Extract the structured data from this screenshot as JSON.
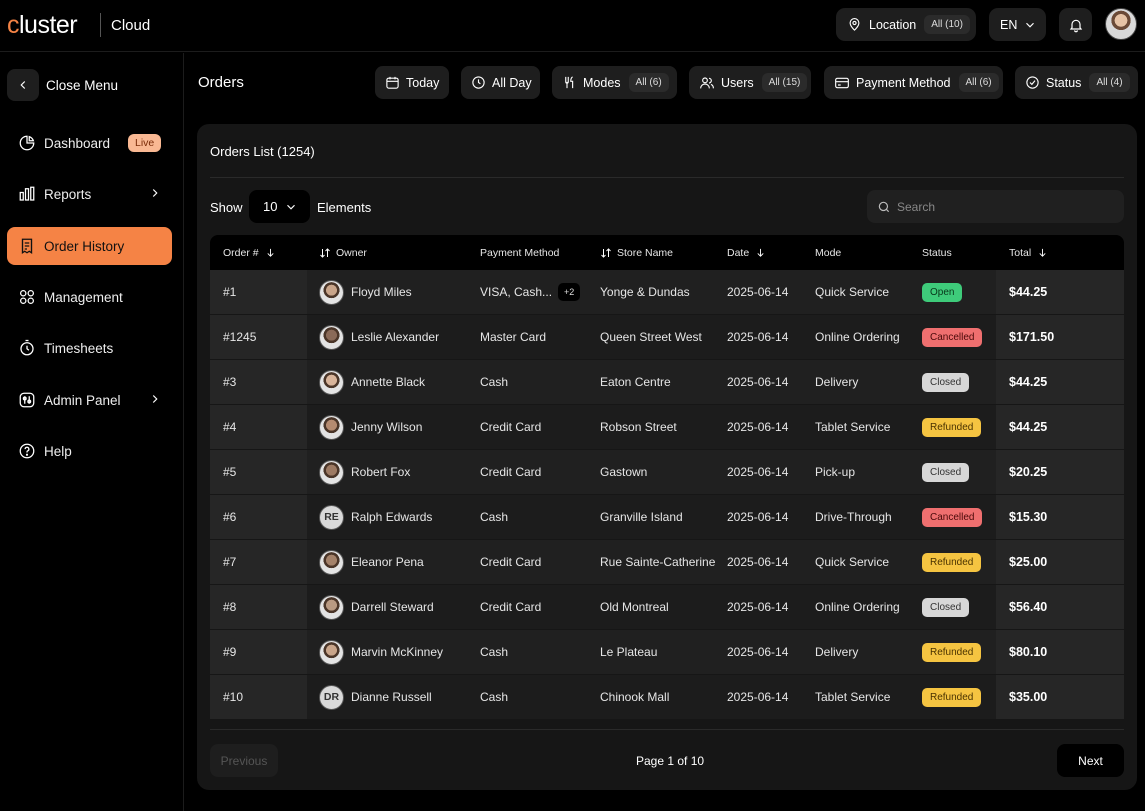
{
  "brand": {
    "logo_first": "c",
    "logo_rest": "luster",
    "product": "Cloud"
  },
  "topbar": {
    "location_label": "Location",
    "location_badge": "All (10)",
    "language": "EN",
    "icons": [
      "location-pin-icon",
      "chevron-down-icon",
      "bell-icon"
    ]
  },
  "sidebar": {
    "close_label": "Close Menu",
    "live_badge": "Live",
    "items": [
      {
        "label": "Dashboard",
        "icon": "dashboard-icon"
      },
      {
        "label": "Reports",
        "icon": "reports-icon"
      },
      {
        "label": "Order History",
        "icon": "order-history-icon",
        "active": true
      },
      {
        "label": "Management",
        "icon": "management-icon"
      },
      {
        "label": "Timesheets",
        "icon": "timesheets-icon"
      },
      {
        "label": "Admin Panel",
        "icon": "admin-panel-icon"
      },
      {
        "label": "Help",
        "icon": "help-icon"
      }
    ]
  },
  "header": {
    "title": "Orders",
    "filters": [
      {
        "label": "Today"
      },
      {
        "label": "All Day"
      },
      {
        "label": "Modes",
        "badge": "All (6)"
      },
      {
        "label": "Users",
        "badge": "All (15)"
      },
      {
        "label": "Payment Method",
        "badge": "All (6)"
      },
      {
        "label": "Status",
        "badge": "All (4)"
      }
    ]
  },
  "orders": {
    "title": "Orders List (1254)",
    "show_label": "Show",
    "show_value": "10",
    "elements_label": "Elements",
    "search_placeholder": "Search",
    "columns": [
      "Order #",
      "Owner",
      "Payment Method",
      "Store Name",
      "Date",
      "Mode",
      "Status",
      "Total"
    ],
    "rows": [
      {
        "order": "#1",
        "owner": "Floyd Miles",
        "payment": "VISA, Cash...",
        "more": "+2",
        "store": "Yonge & Dundas",
        "date": "2025-06-14",
        "mode": "Quick Service",
        "status": "Open",
        "total": "$44.25",
        "avatar": "photo"
      },
      {
        "order": "#1245",
        "owner": "Leslie Alexander",
        "payment": "Master Card",
        "store": "Queen Street West",
        "date": "2025-06-14",
        "mode": "Online Ordering",
        "status": "Cancelled",
        "total": "$171.50",
        "avatar": "photo"
      },
      {
        "order": "#3",
        "owner": "Annette Black",
        "payment": "Cash",
        "store": "Eaton Centre",
        "date": "2025-06-14",
        "mode": "Delivery",
        "status": "Closed",
        "total": "$44.25",
        "avatar": "photo"
      },
      {
        "order": "#4",
        "owner": "Jenny Wilson",
        "payment": "Credit Card",
        "store": "Robson Street",
        "date": "2025-06-14",
        "mode": "Tablet Service",
        "status": "Refunded",
        "total": "$44.25",
        "avatar": "photo"
      },
      {
        "order": "#5",
        "owner": "Robert Fox",
        "payment": "Credit Card",
        "store": "Gastown",
        "date": "2025-06-14",
        "mode": "Pick-up",
        "status": "Closed",
        "total": "$20.25",
        "avatar": "photo"
      },
      {
        "order": "#6",
        "owner": "Ralph Edwards",
        "payment": "Cash",
        "store": "Granville Island",
        "date": "2025-06-14",
        "mode": "Drive-Through",
        "status": "Cancelled",
        "total": "$15.30",
        "avatar": "initials",
        "initials": "RE"
      },
      {
        "order": "#7",
        "owner": "Eleanor Pena",
        "payment": "Credit Card",
        "store": "Rue Sainte-Catherine",
        "date": "2025-06-14",
        "mode": "Quick Service",
        "status": "Refunded",
        "total": "$25.00",
        "avatar": "photo"
      },
      {
        "order": "#8",
        "owner": "Darrell Steward",
        "payment": "Credit Card",
        "store": "Old Montreal",
        "date": "2025-06-14",
        "mode": "Online Ordering",
        "status": "Closed",
        "total": "$56.40",
        "avatar": "photo"
      },
      {
        "order": "#9",
        "owner": "Marvin McKinney",
        "payment": "Cash",
        "store": "Le Plateau",
        "date": "2025-06-14",
        "mode": "Delivery",
        "status": "Refunded",
        "total": "$80.10",
        "avatar": "photo"
      },
      {
        "order": "#10",
        "owner": "Dianne Russell",
        "payment": "Cash",
        "store": "Chinook Mall",
        "date": "2025-06-14",
        "mode": "Tablet Service",
        "status": "Refunded",
        "total": "$35.00",
        "avatar": "initials",
        "initials": "DR"
      }
    ],
    "pagination": {
      "previous": "Previous",
      "page": "Page 1 of 10",
      "next": "Next"
    }
  },
  "colors": {
    "accent": "#f58345",
    "open": "#3ecb7a",
    "cancelled": "#ef6f6f",
    "closed": "#d7d7d7",
    "refunded": "#f5c441"
  }
}
